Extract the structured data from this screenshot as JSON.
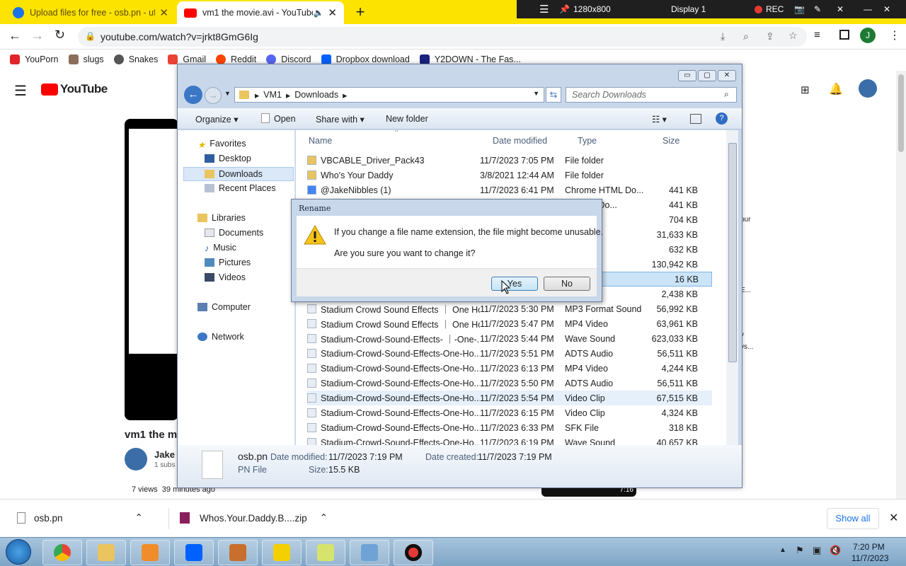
{
  "browser": {
    "tabs": [
      {
        "title": "Upload files for free - osb.pn - ufile.io",
        "active": false
      },
      {
        "title": "vm1 the movie.avi - YouTube",
        "active": true
      }
    ],
    "url": "youtube.com/watch?v=jrkt8GmG6Ig",
    "profile_initial": "J",
    "bookmarks": [
      "YouPorn",
      "slugs",
      "Snakes",
      "Gmail",
      "Reddit",
      "Discord",
      "Dropbox download",
      "Y2DOWN - The Fas..."
    ]
  },
  "recorder": {
    "resolution": "1280x800",
    "display": "Display 1",
    "rec_label": "REC"
  },
  "youtube": {
    "logo": "YouTube",
    "video_title": "vm1 the mo",
    "channel": "Jake",
    "subs": "1 subs",
    "meta": "7 views  39 minutes ago",
    "side_text": [
      "our",
      "E...",
      "y",
      "ys..."
    ],
    "duration": "7:16"
  },
  "explorer": {
    "path": [
      "VM1",
      "Downloads"
    ],
    "search_placeholder": "Search Downloads",
    "commands": {
      "organize": "Organize",
      "open": "Open",
      "share": "Share with",
      "newfolder": "New folder"
    },
    "nav": {
      "favorites": "Favorites",
      "desktop": "Desktop",
      "downloads": "Downloads",
      "recent": "Recent Places",
      "libraries": "Libraries",
      "documents": "Documents",
      "music": "Music",
      "pictures": "Pictures",
      "videos": "Videos",
      "computer": "Computer",
      "network": "Network"
    },
    "columns": {
      "name": "Name",
      "date": "Date modified",
      "type": "Type",
      "size": "Size"
    },
    "files": [
      {
        "name": "VBCABLE_Driver_Pack43",
        "date": "11/7/2023 7:05 PM",
        "type": "File folder",
        "size": ""
      },
      {
        "name": "Who's Your Daddy",
        "date": "3/8/2021 12:44 AM",
        "type": "File folder",
        "size": ""
      },
      {
        "name": "@JakeNibbles (1)",
        "date": "11/7/2023 6:41 PM",
        "type": "Chrome HTML Do...",
        "size": "441 KB"
      },
      {
        "name": "",
        "date": "",
        "type": "e HTML Do...",
        "size": "441 KB"
      },
      {
        "name": "",
        "date": "",
        "type": "nage",
        "size": "704 KB"
      },
      {
        "name": "",
        "date": "",
        "type": "ation",
        "size": "31,633 KB"
      },
      {
        "name": "",
        "date": "",
        "type": "ation",
        "size": "632 KB"
      },
      {
        "name": "",
        "date": "",
        "type": "ation",
        "size": "130,942 KB"
      },
      {
        "name": "",
        "date": "",
        "type": "",
        "size": "16 KB"
      },
      {
        "name": "",
        "date": "",
        "type": "ation",
        "size": "2,438 KB"
      },
      {
        "name": "Stadium Crowd Sound Effects ｜ One Ho...",
        "date": "11/7/2023 5:30 PM",
        "type": "MP3 Format Sound",
        "size": "56,992 KB"
      },
      {
        "name": "Stadium Crowd Sound Effects ｜ One Ho...",
        "date": "11/7/2023 5:47 PM",
        "type": "MP4 Video",
        "size": "63,961 KB"
      },
      {
        "name": "Stadium-Crowd-Sound-Effects- ｜-One-...",
        "date": "11/7/2023 5:44 PM",
        "type": "Wave Sound",
        "size": "623,033 KB"
      },
      {
        "name": "Stadium-Crowd-Sound-Effects-One-Ho...",
        "date": "11/7/2023 5:51 PM",
        "type": "ADTS Audio",
        "size": "56,511 KB"
      },
      {
        "name": "Stadium-Crowd-Sound-Effects-One-Ho...",
        "date": "11/7/2023 6:13 PM",
        "type": "MP4 Video",
        "size": "4,244 KB"
      },
      {
        "name": "Stadium-Crowd-Sound-Effects-One-Ho...",
        "date": "11/7/2023 5:50 PM",
        "type": "ADTS Audio",
        "size": "56,511 KB"
      },
      {
        "name": "Stadium-Crowd-Sound-Effects-One-Ho...",
        "date": "11/7/2023 5:54 PM",
        "type": "Video Clip",
        "size": "67,515 KB"
      },
      {
        "name": "Stadium-Crowd-Sound-Effects-One-Ho...",
        "date": "11/7/2023 6:15 PM",
        "type": "Video Clip",
        "size": "4,324 KB"
      },
      {
        "name": "Stadium-Crowd-Sound-Effects-One-Ho...",
        "date": "11/7/2023 6:33 PM",
        "type": "SFK File",
        "size": "318 KB"
      },
      {
        "name": "Stadium-Crowd-Sound-Effects-One-Ho...",
        "date": "11/7/2023 6:19 PM",
        "type": "Wave Sound",
        "size": "40,657 KB"
      }
    ],
    "details": {
      "name": "osb.pn",
      "type": "PN File",
      "modified_label": "Date modified:",
      "modified": "11/7/2023 7:19 PM",
      "created_label": "Date created:",
      "created": "11/7/2023 7:19 PM",
      "size_label": "Size:",
      "size": "15.5 KB"
    }
  },
  "dialog": {
    "title": "Rename",
    "message": "If you change a file name extension, the file might become unusable.",
    "question": "Are you sure you want to change it?",
    "yes": "Yes",
    "no": "No"
  },
  "downloads": {
    "items": [
      "osb.pn",
      "Whos.Your.Daddy.B....zip"
    ],
    "show_all": "Show all"
  },
  "taskbar": {
    "time": "7:20 PM",
    "date": "11/7/2023"
  }
}
